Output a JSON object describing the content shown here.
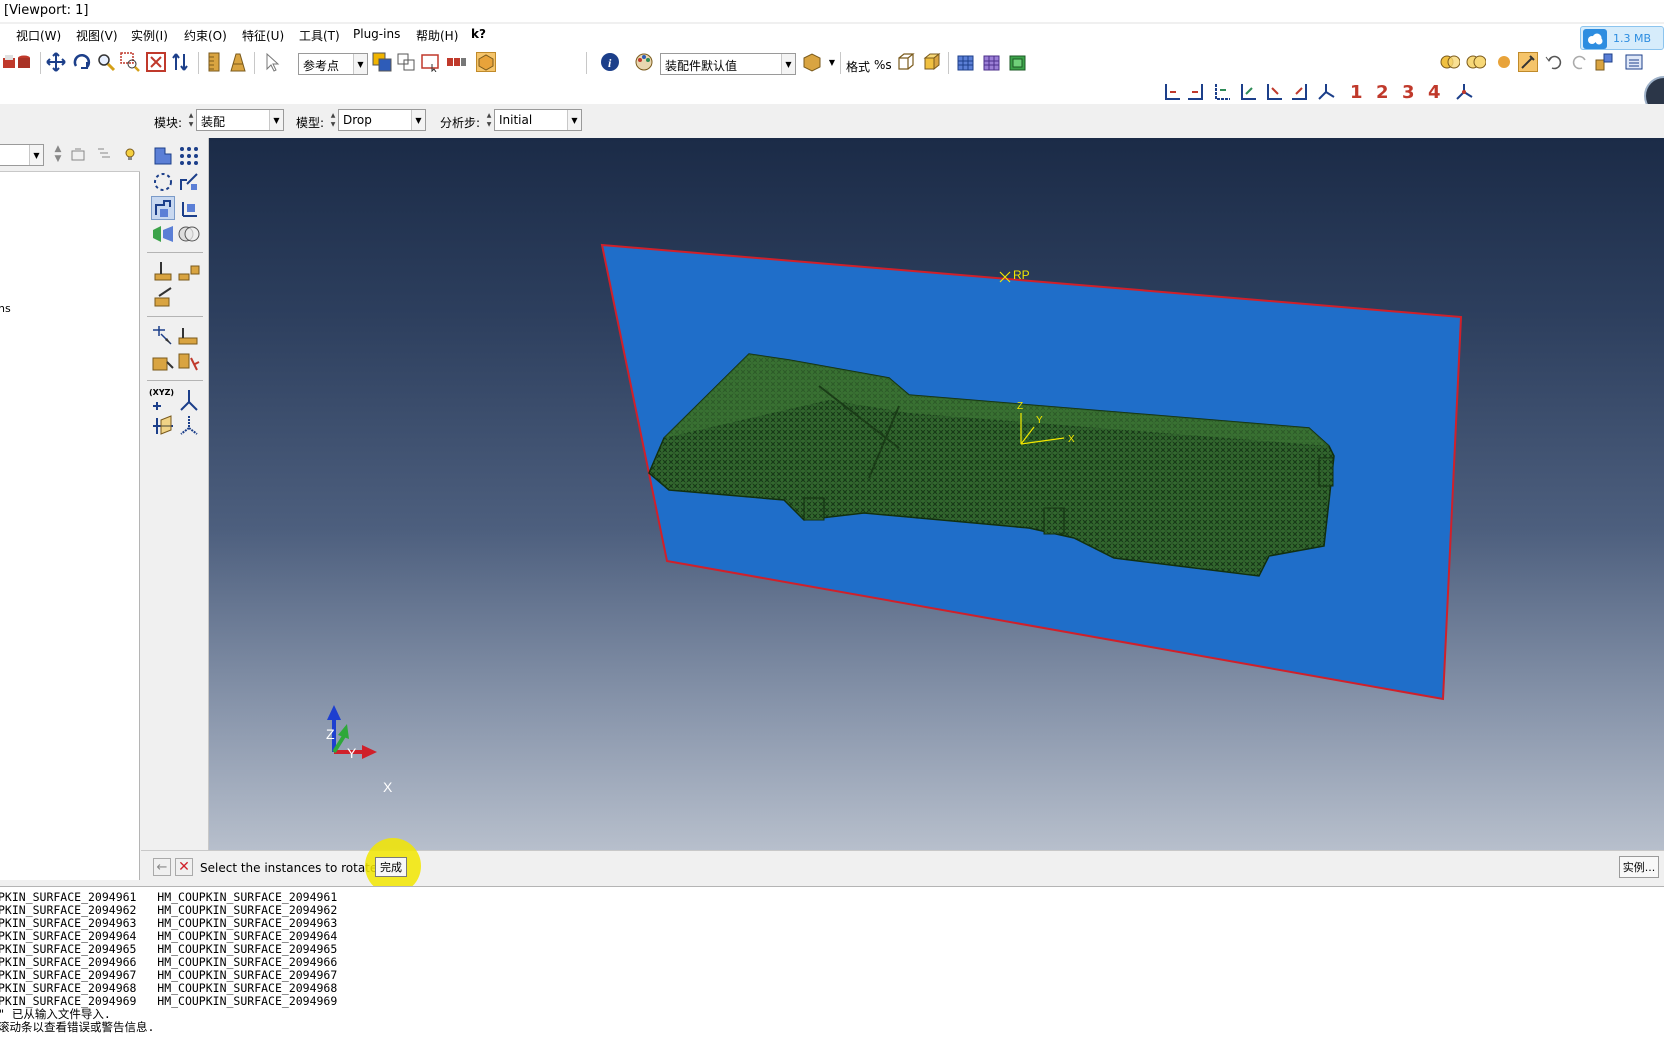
{
  "window": {
    "title": "[Viewport: 1]"
  },
  "menu": {
    "items": [
      "视口(W)",
      "视图(V)",
      "实例(I)",
      "约束(O)",
      "特征(U)",
      "工具(T)",
      "Plug-ins",
      "帮助(H)",
      "k?"
    ]
  },
  "toolbar": {
    "selection_filter": "参考点",
    "display_group": "装配件默认值",
    "format_label": "格式",
    "format_value": "%s",
    "datum_labels": [
      "1",
      "2",
      "3",
      "4"
    ],
    "network_speed": "1.3 MB"
  },
  "context": {
    "module_label": "模块:",
    "module_value": "装配",
    "model_label": "模型:",
    "model_value": "Drop",
    "step_label": "分析步:",
    "step_value": "Initial"
  },
  "tree": {
    "partial_text": "ns"
  },
  "viewport": {
    "rp_label": "RP",
    "local_axes": {
      "z": "Z",
      "y": "Y",
      "x": "X"
    },
    "triad": {
      "z": "Z",
      "y": "Y",
      "x": "X"
    }
  },
  "prompt": {
    "text": "Select the instances to rotate",
    "done_button": "完成",
    "instances_button": "实例..."
  },
  "messages": {
    "rows": [
      [
        "PKIN_SURFACE_2094961",
        "HM_COUPKIN_SURFACE_2094961"
      ],
      [
        "PKIN_SURFACE_2094962",
        "HM_COUPKIN_SURFACE_2094962"
      ],
      [
        "PKIN_SURFACE_2094963",
        "HM_COUPKIN_SURFACE_2094963"
      ],
      [
        "PKIN_SURFACE_2094964",
        "HM_COUPKIN_SURFACE_2094964"
      ],
      [
        "PKIN_SURFACE_2094965",
        "HM_COUPKIN_SURFACE_2094965"
      ],
      [
        "PKIN_SURFACE_2094966",
        "HM_COUPKIN_SURFACE_2094966"
      ],
      [
        "PKIN_SURFACE_2094967",
        "HM_COUPKIN_SURFACE_2094967"
      ],
      [
        "PKIN_SURFACE_2094968",
        "HM_COUPKIN_SURFACE_2094968"
      ],
      [
        "PKIN_SURFACE_2094969",
        "HM_COUPKIN_SURFACE_2094969"
      ]
    ],
    "import_line": "\" 已从输入文件导入.",
    "hint_line": "滚动条以查看错误或警告信息."
  },
  "colors": {
    "viewport_top": "#1b2b47",
    "viewport_bottom": "#b7bfcc",
    "plane_fill": "#1f6ec9",
    "plane_edge": "#d0202a",
    "mesh_green": "#2e6a2b",
    "highlight_yellow": "#f2e600"
  }
}
